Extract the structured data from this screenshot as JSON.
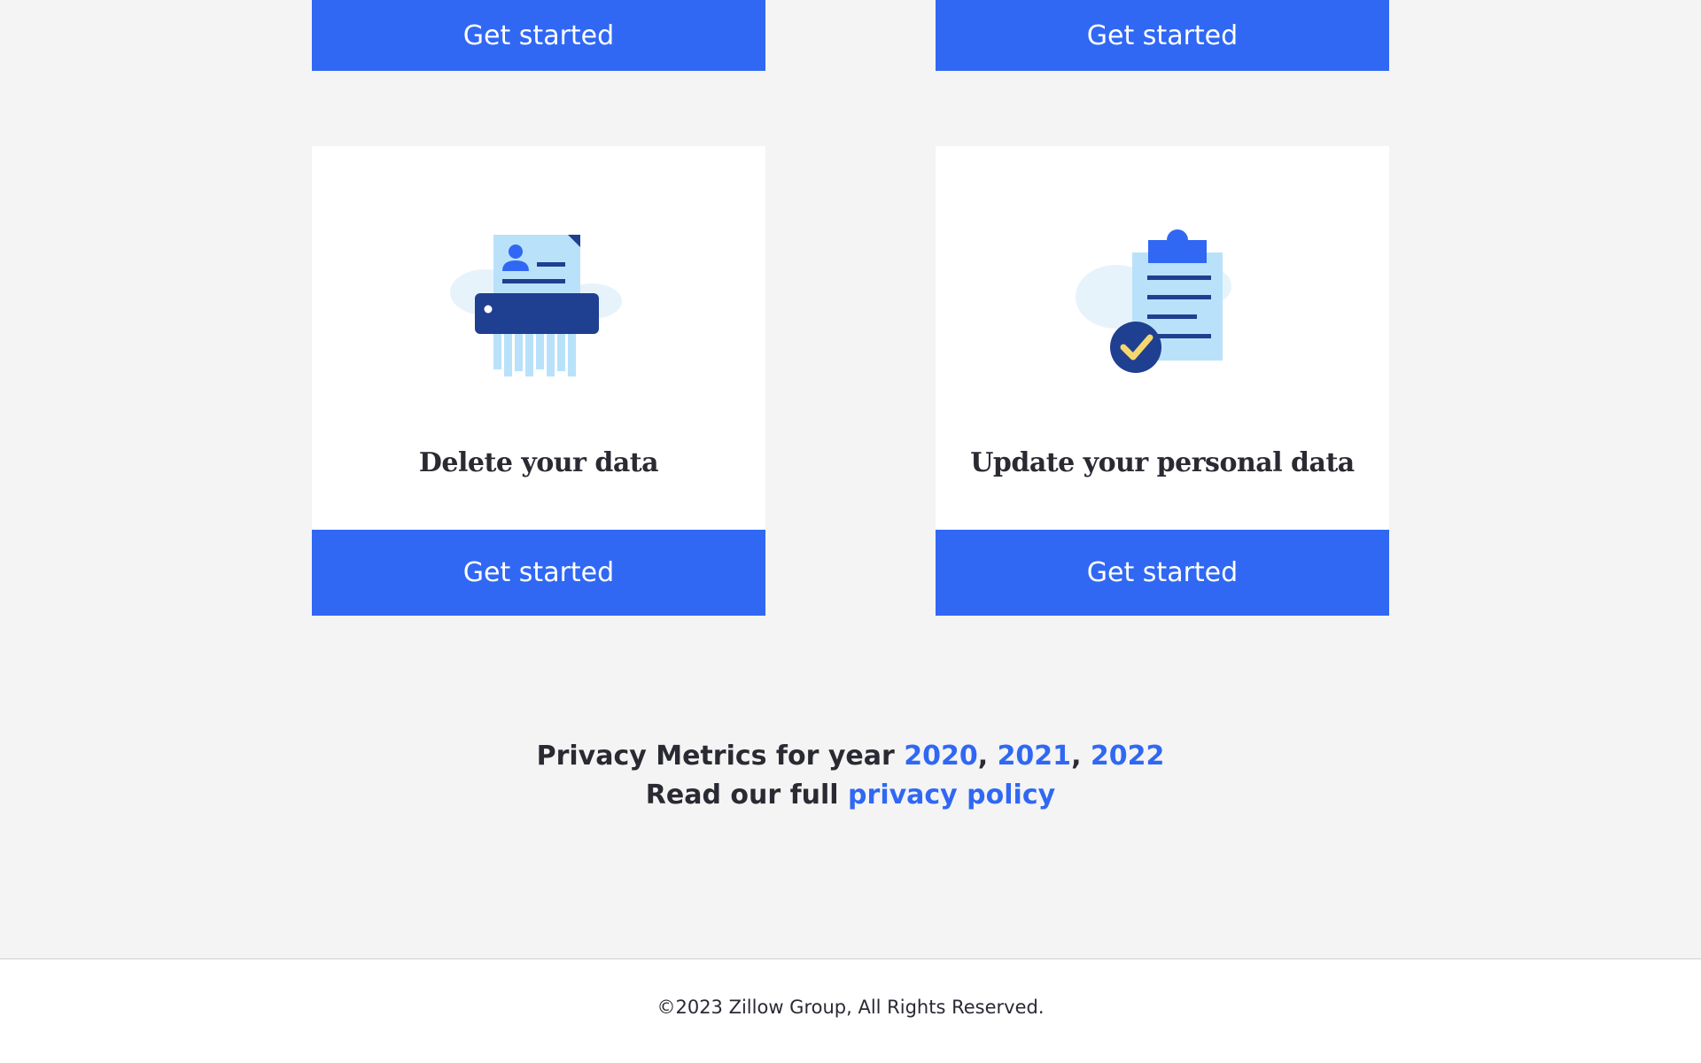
{
  "top_cards": [
    {
      "button_label": "Get started"
    },
    {
      "button_label": "Get started"
    }
  ],
  "cards": [
    {
      "title": "Delete your data",
      "button_label": "Get started",
      "illustration": "document-shredder-icon"
    },
    {
      "title": "Update your personal data",
      "button_label": "Get started",
      "illustration": "clipboard-check-icon"
    }
  ],
  "metrics": {
    "prefix": "Privacy Metrics for year ",
    "years": [
      "2020",
      "2021",
      "2022"
    ],
    "policy_prefix": "Read our full ",
    "policy_link": "privacy policy"
  },
  "footer": {
    "copyright": "©2023 Zillow Group, All Rights Reserved."
  },
  "colors": {
    "accent": "#3068f4",
    "navy": "#1f3f91",
    "light_blue": "#b9e2fa",
    "check_yellow": "#f5d76e",
    "background": "#f4f4f4"
  }
}
